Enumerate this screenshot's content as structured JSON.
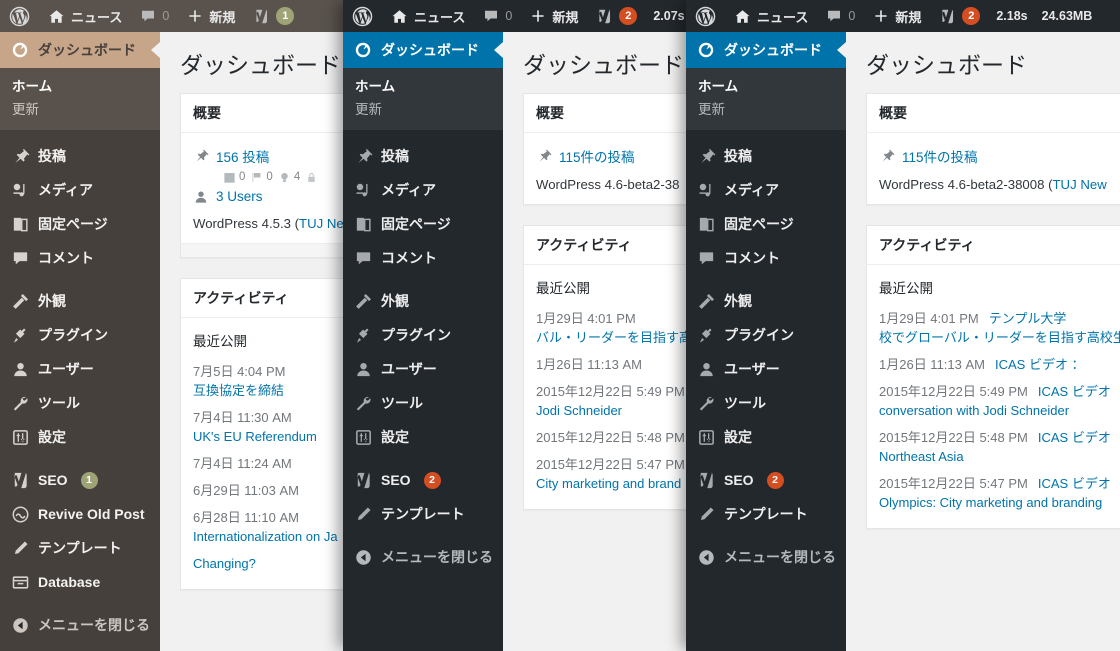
{
  "panels": [
    {
      "id": "panel-back",
      "theme": {
        "bar_bg": "#5a534d",
        "side_bg": "#46403c",
        "current_bg": "#c7a589",
        "current_text": "#46403c",
        "sub_bg": "#59524c",
        "text": "#f3f2f1",
        "muted": "#ccc5c0",
        "badge": "#9ea476",
        "arrow": "#f1f1f1"
      },
      "adminbar": {
        "wp_logo": "wordpress-icon",
        "site_name": "ニュース",
        "comments_count": "0",
        "new_label": "新規",
        "seo_badge": "1",
        "timer": "",
        "memory": ""
      },
      "sidebar": {
        "current_label": "ダッシュボード",
        "submenu": [
          "ホーム",
          "更新"
        ],
        "groups": [
          [
            {
              "label": "投稿",
              "icon": "pin-icon"
            },
            {
              "label": "メディア",
              "icon": "media-icon"
            },
            {
              "label": "固定ページ",
              "icon": "page-icon"
            },
            {
              "label": "コメント",
              "icon": "comment-icon"
            }
          ],
          [
            {
              "label": "外観",
              "icon": "appearance-icon"
            },
            {
              "label": "プラグイン",
              "icon": "plugin-icon"
            },
            {
              "label": "ユーザー",
              "icon": "user-icon"
            },
            {
              "label": "ツール",
              "icon": "tools-icon"
            },
            {
              "label": "設定",
              "icon": "settings-icon"
            }
          ],
          [
            {
              "label": "SEO",
              "icon": "yoast-icon",
              "badge": "1"
            },
            {
              "label": "Revive Old Post",
              "icon": "revive-icon"
            },
            {
              "label": "テンプレート",
              "icon": "pencil-icon"
            },
            {
              "label": "Database",
              "icon": "database-icon"
            }
          ],
          [
            {
              "label": "メニューを閉じる",
              "icon": "collapse-icon"
            }
          ]
        ]
      },
      "content": {
        "title": "ダッシュボード",
        "overview": {
          "heading": "概要",
          "posts": "156 投稿",
          "mini": [
            {
              "icon": "calendar-icon",
              "value": "0"
            },
            {
              "icon": "flag-icon",
              "value": "0"
            },
            {
              "icon": "bulb-icon",
              "value": "4"
            },
            {
              "icon": "lock-icon",
              "value": ""
            }
          ],
          "users": "3 Users",
          "version_prefix": "WordPress 4.5.3 (",
          "version_link": "TUJ New"
        },
        "activity": {
          "heading": "アクティビティ",
          "subheading": "最近公開",
          "items": [
            {
              "date": "7月5日 4:04 PM",
              "link": "互換協定を締結"
            },
            {
              "date": "7月4日 11:30 AM",
              "link": "UK's EU Referendum"
            },
            {
              "date": "7月4日 11:24 AM",
              "link": ""
            },
            {
              "date": "6月29日 11:03 AM",
              "link": ""
            },
            {
              "date": "6月28日 11:10 AM",
              "link": "Internationalization on Ja"
            },
            {
              "date": "",
              "link": "Changing?"
            }
          ]
        }
      }
    },
    {
      "id": "panel-mid",
      "theme": {
        "bar_bg": "#23282d",
        "side_bg": "#23282d",
        "current_bg": "#0073aa",
        "current_text": "#ffffff",
        "sub_bg": "#32373c",
        "text": "#eeeeee",
        "muted": "#b4b9be",
        "badge": "#d54e21",
        "arrow": "#f1f1f1"
      },
      "adminbar": {
        "wp_logo": "wordpress-icon",
        "site_name": "ニュース",
        "comments_count": "0",
        "new_label": "新規",
        "seo_badge": "2",
        "timer": "2.07s",
        "memory": ""
      },
      "sidebar": {
        "current_label": "ダッシュボード",
        "submenu": [
          "ホーム",
          "更新"
        ],
        "groups": [
          [
            {
              "label": "投稿",
              "icon": "pin-icon"
            },
            {
              "label": "メディア",
              "icon": "media-icon"
            },
            {
              "label": "固定ページ",
              "icon": "page-icon"
            },
            {
              "label": "コメント",
              "icon": "comment-icon"
            }
          ],
          [
            {
              "label": "外観",
              "icon": "appearance-icon"
            },
            {
              "label": "プラグイン",
              "icon": "plugin-icon"
            },
            {
              "label": "ユーザー",
              "icon": "user-icon"
            },
            {
              "label": "ツール",
              "icon": "tools-icon"
            },
            {
              "label": "設定",
              "icon": "settings-icon"
            }
          ],
          [
            {
              "label": "SEO",
              "icon": "yoast-icon",
              "badge": "2"
            },
            {
              "label": "テンプレート",
              "icon": "pencil-icon"
            }
          ],
          [
            {
              "label": "メニューを閉じる",
              "icon": "collapse-icon"
            }
          ]
        ]
      },
      "content": {
        "title": "ダッシュボード",
        "overview": {
          "heading": "概要",
          "posts": "115件の投稿",
          "mini": [],
          "users": "",
          "version_prefix": "WordPress 4.6-beta2-38",
          "version_link": ""
        },
        "activity": {
          "heading": "アクティビティ",
          "subheading": "最近公開",
          "items": [
            {
              "date": "1月29日 4:01 PM",
              "link": "バル・リーダーを目指す高"
            },
            {
              "date": "1月26日 11:13 AM",
              "link": ""
            },
            {
              "date": "2015年12月22日 5:49 PM",
              "link": "Jodi Schneider"
            },
            {
              "date": "2015年12月22日 5:48 PM",
              "link": ""
            },
            {
              "date": "2015年12月22日 5:47 PM",
              "link": "City marketing and brand"
            }
          ]
        }
      }
    },
    {
      "id": "panel-front",
      "theme": {
        "bar_bg": "#23282d",
        "side_bg": "#23282d",
        "current_bg": "#0073aa",
        "current_text": "#ffffff",
        "sub_bg": "#32373c",
        "text": "#eeeeee",
        "muted": "#b4b9be",
        "badge": "#d54e21",
        "arrow": "#f1f1f1"
      },
      "adminbar": {
        "wp_logo": "wordpress-icon",
        "site_name": "ニュース",
        "comments_count": "0",
        "new_label": "新規",
        "seo_badge": "2",
        "timer": "2.18s",
        "memory": "24.63MB"
      },
      "sidebar": {
        "current_label": "ダッシュボード",
        "submenu": [
          "ホーム",
          "更新"
        ],
        "groups": [
          [
            {
              "label": "投稿",
              "icon": "pin-icon"
            },
            {
              "label": "メディア",
              "icon": "media-icon"
            },
            {
              "label": "固定ページ",
              "icon": "page-icon"
            },
            {
              "label": "コメント",
              "icon": "comment-icon"
            }
          ],
          [
            {
              "label": "外観",
              "icon": "appearance-icon"
            },
            {
              "label": "プラグイン",
              "icon": "plugin-icon"
            },
            {
              "label": "ユーザー",
              "icon": "user-icon"
            },
            {
              "label": "ツール",
              "icon": "tools-icon"
            },
            {
              "label": "設定",
              "icon": "settings-icon"
            }
          ],
          [
            {
              "label": "SEO",
              "icon": "yoast-icon",
              "badge": "2"
            },
            {
              "label": "テンプレート",
              "icon": "pencil-icon"
            }
          ],
          [
            {
              "label": "メニューを閉じる",
              "icon": "collapse-icon"
            }
          ]
        ]
      },
      "content": {
        "title": "ダッシュボード",
        "overview": {
          "heading": "概要",
          "posts": "115件の投稿",
          "mini": [],
          "users": "",
          "version_prefix": "WordPress 4.6-beta2-38008 (",
          "version_link": "TUJ New"
        },
        "activity": {
          "heading": "アクティビティ",
          "subheading": "最近公開",
          "items": [
            {
              "date": "1月29日 4:01 PM",
              "link": "テンプル大学",
              "link2": "校でグローバル・リーダーを目指す高校生"
            },
            {
              "date": "1月26日 11:13 AM",
              "link": "ICAS ビデオ ："
            },
            {
              "date": "2015年12月22日 5:49 PM",
              "link": "ICAS ビデオ",
              "link2": "conversation with Jodi Schneider"
            },
            {
              "date": "2015年12月22日 5:48 PM",
              "link": "ICAS ビデオ",
              "link2": "Northeast Asia"
            },
            {
              "date": "2015年12月22日 5:47 PM",
              "link": "ICAS ビデオ",
              "link2": "Olympics: City marketing and branding"
            }
          ]
        }
      }
    }
  ]
}
